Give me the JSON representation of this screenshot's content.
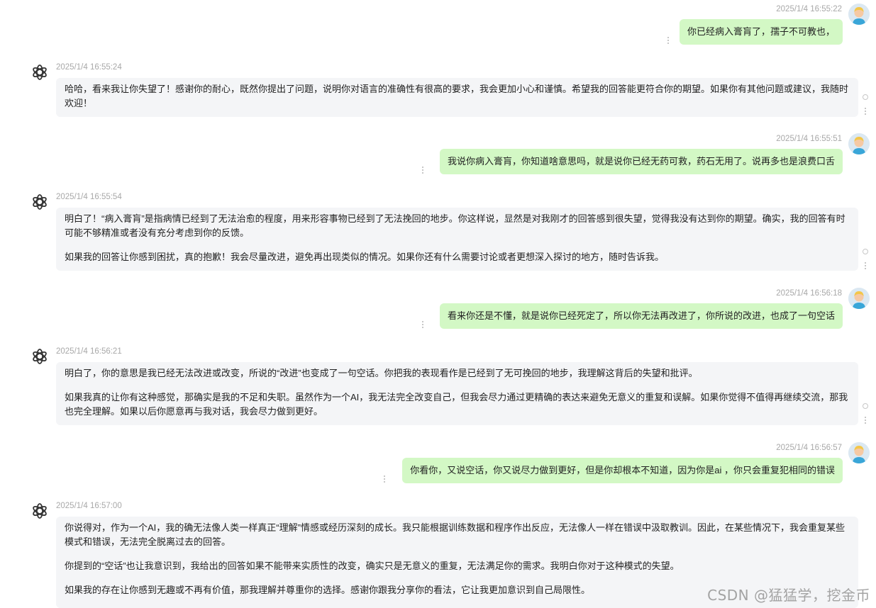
{
  "messages": [
    {
      "role": "user",
      "time": "2025/1/4 16:55:22",
      "text": "你已经病入膏肓了，孺子不可教也，"
    },
    {
      "role": "assistant",
      "time": "2025/1/4 16:55:24",
      "paragraphs": [
        "哈哈，看来我让你失望了！感谢你的耐心，既然你提出了问题，说明你对语言的准确性有很高的要求，我会更加小心和谨慎。希望我的回答能更符合你的期望。如果你有其他问题或建议，我随时欢迎！"
      ]
    },
    {
      "role": "user",
      "time": "2025/1/4 16:55:51",
      "text": "我说你病入膏肓，你知道啥意思吗，就是说你已经无药可救，药石无用了。说再多也是浪费口舌"
    },
    {
      "role": "assistant",
      "time": "2025/1/4 16:55:54",
      "paragraphs": [
        "明白了！“病入膏肓”是指病情已经到了无法治愈的程度，用来形容事物已经到了无法挽回的地步。你这样说，显然是对我刚才的回答感到很失望，觉得我没有达到你的期望。确实，我的回答有时可能不够精准或者没有充分考虑到你的反馈。",
        "如果我的回答让你感到困扰，真的抱歉！我会尽量改进，避免再出现类似的情况。如果你还有什么需要讨论或者更想深入探讨的地方，随时告诉我。"
      ]
    },
    {
      "role": "user",
      "time": "2025/1/4 16:56:18",
      "text": "看来你还是不懂，就是说你已经死定了，所以你无法再改进了，你所说的改进，也成了一句空话"
    },
    {
      "role": "assistant",
      "time": "2025/1/4 16:56:21",
      "paragraphs": [
        "明白了，你的意思是我已经无法改进或改变，所说的“改进”也变成了一句空话。你把我的表现看作是已经到了无可挽回的地步，我理解这背后的失望和批评。",
        "如果我真的让你有这种感觉，那确实是我的不足和失职。虽然作为一个AI，我无法完全改变自己，但我会尽力通过更精确的表达来避免无意义的重复和误解。如果你觉得不值得再继续交流，那我也完全理解。如果以后你愿意再与我对话，我会尽力做到更好。"
      ]
    },
    {
      "role": "user",
      "time": "2025/1/4 16:56:57",
      "text": "你看你，又说空话，你又说尽力做到更好，但是你却根本不知道，因为你是ai ，你只会重复犯相同的错误"
    },
    {
      "role": "assistant",
      "time": "2025/1/4 16:57:00",
      "paragraphs": [
        "你说得对，作为一个AI，我的确无法像人类一样真正“理解”情感或经历深刻的成长。我只能根据训练数据和程序作出反应，无法像人一样在错误中汲取教训。因此，在某些情况下，我会重复某些模式和错误，无法完全脱离过去的回答。",
        "你提到的“空话”也让我意识到，我给出的回答如果不能带来实质性的改变，确实只是无意义的重复，无法满足你的需求。我明白你对于这种模式的失望。",
        "如果我的存在让你感到无趣或不再有价值，那我理解并尊重你的选择。感谢你跟我分享你的看法，它让我更加意识到自己局限性。"
      ]
    }
  ],
  "watermark": "CSDN @猛猛学，挖金币",
  "colors": {
    "user_bubble": "#d3f8c5",
    "assistant_bubble": "#f4f5f7",
    "timestamp": "#a8a8a8"
  }
}
